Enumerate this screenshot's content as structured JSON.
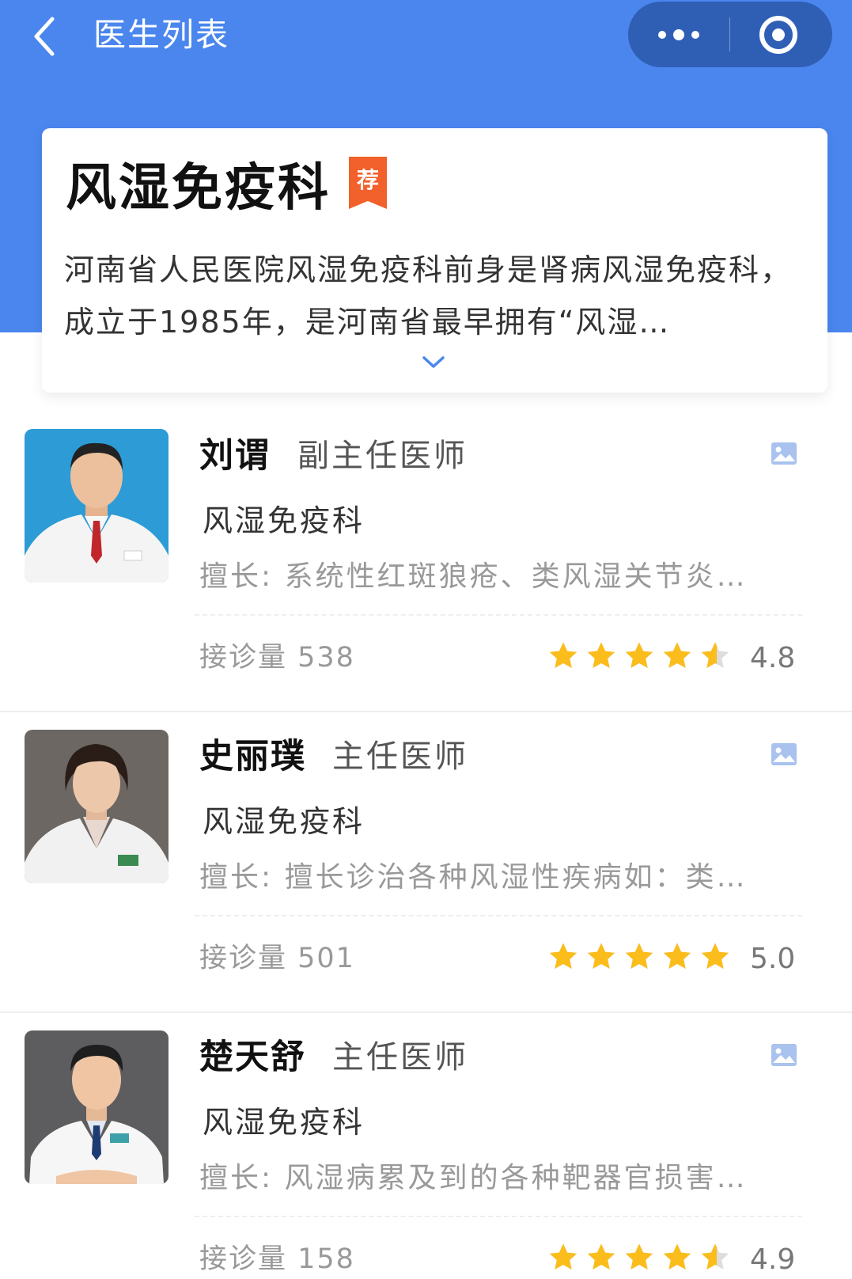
{
  "nav": {
    "title": "医生列表",
    "back_icon": "chevron-left-icon",
    "more_icon": "more-dots-icon",
    "close_icon": "target-circle-icon"
  },
  "department": {
    "name": "风湿免疫科",
    "badge": "荐",
    "description": "河南省人民医院风湿免疫科前身是肾病风湿免疫科，成立于1985年，是河南省最早拥有“风湿…",
    "expand_icon": "chevron-down-icon"
  },
  "colors": {
    "header_blue": "#4a86ee",
    "badge_orange": "#f2602b",
    "star_yellow": "#fbbd1c",
    "star_gray": "#dddddd"
  },
  "doctors": [
    {
      "name": "刘谓",
      "title": "副主任医师",
      "department": "风湿免疫科",
      "skill": "擅长: 系统性红斑狼疮、类风湿关节炎…",
      "consult": "接诊量 538",
      "rating": "4.8",
      "rating_value": 4.8
    },
    {
      "name": "史丽璞",
      "title": "主任医师",
      "department": "风湿免疫科",
      "skill": "擅长: 擅长诊治各种风湿性疾病如：类…",
      "consult": "接诊量 501",
      "rating": "5.0",
      "rating_value": 5.0
    },
    {
      "name": "楚天舒",
      "title": "主任医师",
      "department": "风湿免疫科",
      "skill": "擅长: 风湿病累及到的各种靶器官损害…",
      "consult": "接诊量 158",
      "rating": "4.9",
      "rating_value": 4.9
    }
  ]
}
